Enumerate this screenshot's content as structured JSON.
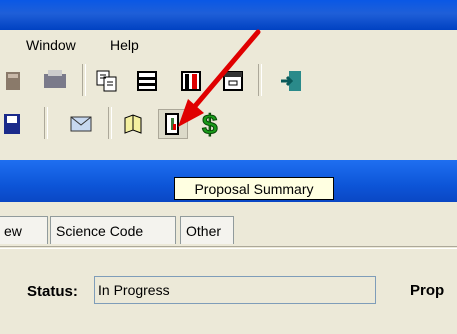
{
  "menu": {
    "window_label": "Window",
    "help_label": "Help"
  },
  "tooltip": {
    "text": "Proposal Summary"
  },
  "tabs": [
    {
      "label": "ew"
    },
    {
      "label": "Science Code"
    },
    {
      "label": "Other"
    }
  ],
  "status": {
    "label": "Status:",
    "value": "In Progress"
  },
  "proposal": {
    "label": "Prop"
  },
  "colors": {
    "title_blue": "#0a58e6",
    "tooltip_bg": "#ffffe1",
    "dollar_green": "#1a9b1a",
    "arrow_red": "#e00000"
  },
  "icons": [
    "doc-icon",
    "print-icon",
    "copy-icon",
    "list-icon",
    "report-icon",
    "calendar-icon",
    "exit-icon",
    "save-icon",
    "mail-icon",
    "open-book-icon",
    "proposal-summary-icon",
    "dollar-icon"
  ]
}
